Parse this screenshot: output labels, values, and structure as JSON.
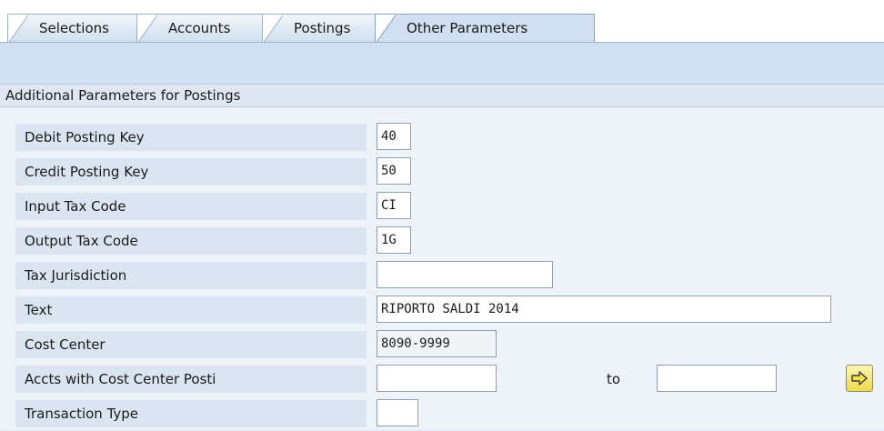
{
  "tabs": [
    {
      "label": "Selections",
      "active": false
    },
    {
      "label": "Accounts",
      "active": false
    },
    {
      "label": "Postings",
      "active": false
    },
    {
      "label": "Other Parameters",
      "active": true
    }
  ],
  "section": {
    "title": "Additional Parameters for Postings"
  },
  "fields": {
    "debit_posting_key": {
      "label": "Debit Posting Key",
      "value": "40"
    },
    "credit_posting_key": {
      "label": "Credit Posting Key",
      "value": "50"
    },
    "input_tax_code": {
      "label": "Input Tax Code",
      "value": "CI"
    },
    "output_tax_code": {
      "label": "Output Tax Code",
      "value": "1G"
    },
    "tax_jurisdiction": {
      "label": "Tax Jurisdiction",
      "value": ""
    },
    "text": {
      "label": "Text",
      "value": "RIPORTO SALDI 2014"
    },
    "cost_center": {
      "label": "Cost Center",
      "value": "8090-9999"
    },
    "accts_cost_center": {
      "label": "Accts with Cost Center Posti",
      "from": "",
      "to_label": "to",
      "to": ""
    },
    "transaction_type": {
      "label": "Transaction Type",
      "value": ""
    }
  },
  "icons": {
    "multiple_selection": "arrow-right-icon"
  },
  "colors": {
    "background": "#e1ebf6",
    "accent_button": "#f5e36a"
  }
}
